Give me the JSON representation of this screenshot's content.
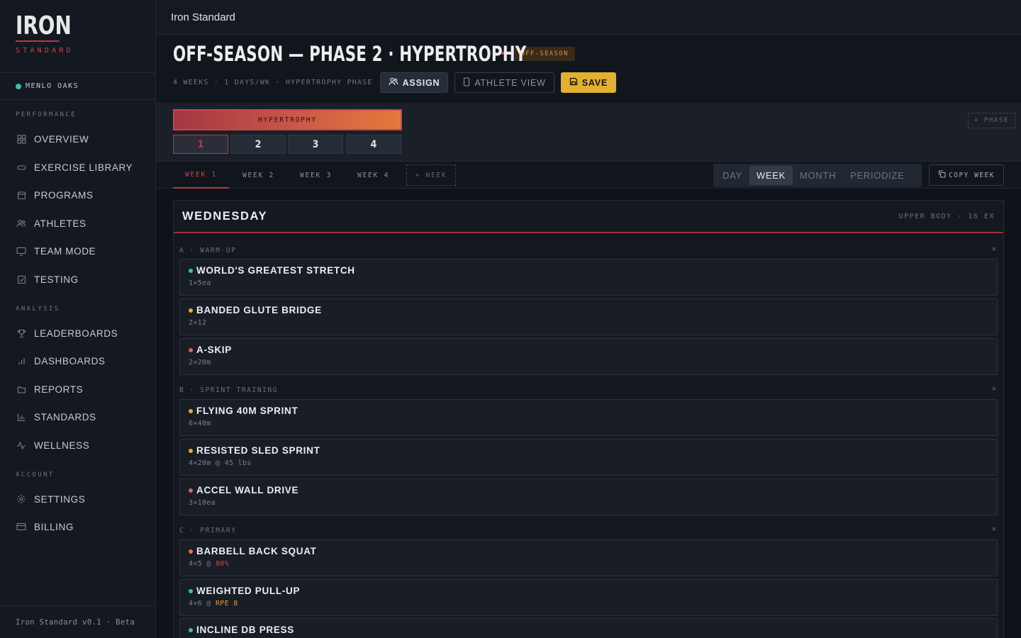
{
  "app": {
    "name": "Iron Standard"
  },
  "brand": {
    "main": "IRON",
    "sub": "STANDARD",
    "accent": "#c8464b"
  },
  "org": {
    "name": "MENLO OAKS",
    "status_color": "#3cbfae"
  },
  "sidebar": {
    "sections": [
      {
        "label": "PERFORMANCE",
        "items": [
          {
            "label": "OVERVIEW",
            "icon": "grid-icon"
          },
          {
            "label": "EXERCISE LIBRARY",
            "icon": "chain-icon"
          },
          {
            "label": "PROGRAMS",
            "icon": "calendar-icon"
          },
          {
            "label": "ATHLETES",
            "icon": "users-icon"
          },
          {
            "label": "TEAM MODE",
            "icon": "monitor-icon"
          },
          {
            "label": "TESTING",
            "icon": "check-square-icon"
          }
        ]
      },
      {
        "label": "ANALYSIS",
        "items": [
          {
            "label": "LEADERBOARDS",
            "icon": "trophy-icon"
          },
          {
            "label": "DASHBOARDS",
            "icon": "bar-chart-icon"
          },
          {
            "label": "REPORTS",
            "icon": "folder-icon"
          },
          {
            "label": "STANDARDS",
            "icon": "column-chart-icon"
          },
          {
            "label": "WELLNESS",
            "icon": "pulse-icon"
          }
        ]
      },
      {
        "label": "ACCOUNT",
        "items": [
          {
            "label": "SETTINGS",
            "icon": "gear-icon"
          },
          {
            "label": "BILLING",
            "icon": "card-icon"
          }
        ]
      }
    ],
    "footer": "Iron Standard v0.1 · Beta"
  },
  "topbar": {
    "title": "Iron Standard"
  },
  "program": {
    "title": "OFF-SEASON — PHASE 2 · HYPERTROPHY",
    "badge": "OFF-SEASON",
    "meta": "4 WEEKS · 1 DAYS/WK · HYPERTROPHY PHASE",
    "buttons": {
      "assign": "ASSIGN",
      "athlete_view": "ATHLETE VIEW",
      "save": "SAVE"
    }
  },
  "phase": {
    "label": "HYPERTROPHY",
    "weeks": [
      "1",
      "2",
      "3",
      "4"
    ],
    "active_week": "1",
    "add_label": "+ PHASE"
  },
  "tabs": {
    "weeks": [
      "WEEK 1",
      "WEEK 2",
      "WEEK 3",
      "WEEK 4"
    ],
    "active": "WEEK 1",
    "add_week": "+ WEEK",
    "views": [
      "DAY",
      "WEEK",
      "MONTH",
      "PERIODIZE"
    ],
    "active_view": "WEEK",
    "copy_week": "COPY WEEK"
  },
  "day": {
    "name": "WEDNESDAY",
    "meta": "UPPER BODY · 16 EX",
    "blocks": [
      {
        "label": "A · WARM-UP",
        "close": "×",
        "exercises": [
          {
            "name": "WORLD'S GREATEST STRETCH",
            "sets": "1×5ea",
            "dot": "#3cbfae"
          },
          {
            "name": "BANDED GLUTE BRIDGE",
            "sets": "2×12",
            "dot": "#e2b033"
          },
          {
            "name": "A-SKIP",
            "sets": "2×20m",
            "dot": "#e0665a"
          }
        ]
      },
      {
        "label": "B · SPRINT TRAINING",
        "close": "×",
        "exercises": [
          {
            "name": "FLYING 40M SPRINT",
            "sets": "6×40m",
            "dot": "#e2b033"
          },
          {
            "name": "RESISTED SLED SPRINT",
            "sets": "4×20m @ 45 lbs",
            "dot": "#e2b033"
          },
          {
            "name": "ACCEL WALL DRIVE",
            "sets": "3×10ea",
            "dot": "#e0665a"
          }
        ]
      },
      {
        "label": "C · PRIMARY",
        "close": "×",
        "exercises": [
          {
            "name": "BARBELL BACK SQUAT",
            "sets": "4×5 @ ",
            "load": "80%",
            "dot": "#e8743e"
          },
          {
            "name": "WEIGHTED PULL-UP",
            "sets": "4×6 @ ",
            "load": "RPE 8",
            "dot": "#3cbfae"
          },
          {
            "name": "INCLINE DB PRESS",
            "sets": "",
            "dot": "#3cbfae"
          }
        ]
      }
    ]
  }
}
